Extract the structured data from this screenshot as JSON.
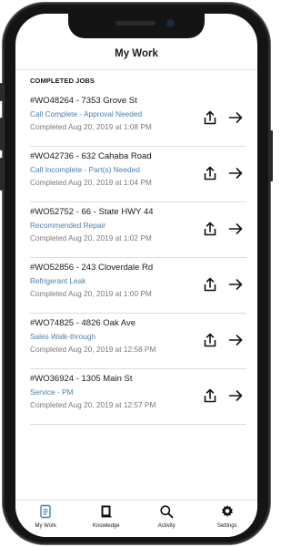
{
  "header": {
    "title": "My Work"
  },
  "section": {
    "label": "COMPLETED JOBS"
  },
  "jobs": [
    {
      "title": "#WO48264 - 7353 Grove St",
      "status": "Call Complete - Approval Needed",
      "completed": "Completed Aug 20, 2019 at 1:08 PM"
    },
    {
      "title": "#WO42736 - 632 Cahaba Road",
      "status": "Call Incomplete - Part(s) Needed",
      "completed": "Completed Aug 20, 2019 at 1:04 PM"
    },
    {
      "title": "#WO52752 - 66 - State HWY 44",
      "status": "Recommended Repair",
      "completed": "Completed Aug 20, 2019 at 1:02 PM"
    },
    {
      "title": "#WO52856 - 243 Cloverdale Rd",
      "status": "Refrigerant Leak",
      "completed": "Completed Aug 20, 2019 at 1:00 PM"
    },
    {
      "title": "#WO74825 - 4826 Oak Ave",
      "status": "Sales Walk-through",
      "completed": "Completed Aug 20, 2019 at 12:58 PM"
    },
    {
      "title": "#WO36924 - 1305 Main St",
      "status": "Service - PM",
      "completed": "Completed Aug 20, 2019 at 12:57 PM"
    }
  ],
  "row_icons": {
    "share": "share-icon",
    "open": "arrow-right-icon"
  },
  "tabs": [
    {
      "label": "My Work",
      "icon": "clipboard-icon",
      "active": true
    },
    {
      "label": "Knowledge",
      "icon": "book-icon",
      "active": false
    },
    {
      "label": "Activity",
      "icon": "search-icon",
      "active": false
    },
    {
      "label": "Settings",
      "icon": "gear-icon",
      "active": false
    }
  ],
  "colors": {
    "accent": "#4a7fae",
    "text": "#1a1a1a",
    "muted": "#7a7a7a",
    "frame": "#141414"
  }
}
